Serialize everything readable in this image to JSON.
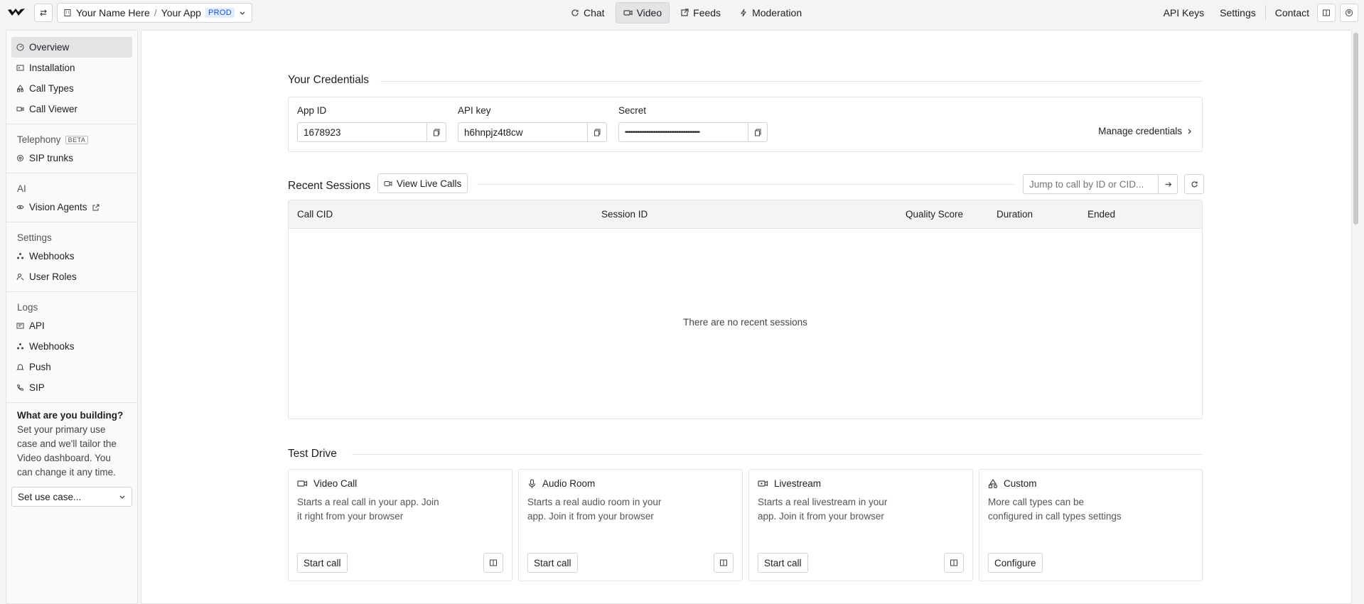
{
  "topbar": {
    "org": "Your Name Here",
    "separator": "/",
    "app": "Your App",
    "env": "PROD",
    "tabs": [
      {
        "label": "Chat",
        "icon": "chat-icon"
      },
      {
        "label": "Video",
        "icon": "video-icon"
      },
      {
        "label": "Feeds",
        "icon": "feeds-icon"
      },
      {
        "label": "Moderation",
        "icon": "moderation-icon"
      }
    ],
    "right_links": [
      "API Keys",
      "Settings",
      "Contact"
    ]
  },
  "sidebar": {
    "items_top": [
      "Overview",
      "Installation",
      "Call Types",
      "Call Viewer"
    ],
    "telephony_title": "Telephony",
    "beta": "BETA",
    "telephony_items": [
      "SIP trunks"
    ],
    "ai_title": "AI",
    "ai_items": [
      "Vision Agents"
    ],
    "settings_title": "Settings",
    "settings_items": [
      "Webhooks",
      "User Roles"
    ],
    "logs_title": "Logs",
    "logs_items": [
      "API",
      "Webhooks",
      "Push",
      "SIP"
    ],
    "note_title": "What are you building?",
    "note_body": "Set your primary use case and we'll tailor the Video dashboard. You can change it any time.",
    "select_value": "Set use case..."
  },
  "credentials": {
    "title": "Your Credentials",
    "app_id_label": "App ID",
    "app_id": "1678923",
    "api_key_label": "API key",
    "api_key": "h6hnpjz4t8cw",
    "secret_label": "Secret",
    "secret": "••••••••••••••••••••••••••••••••••••••••••",
    "manage": "Manage credentials"
  },
  "sessions": {
    "title": "Recent Sessions",
    "view_live": "View Live Calls",
    "jump_placeholder": "Jump to call by ID or CID...",
    "columns": [
      "Call CID",
      "Session ID",
      "Quality Score",
      "Duration",
      "Ended"
    ],
    "empty": "There are no recent sessions"
  },
  "test_drive": {
    "title": "Test Drive",
    "cards": [
      {
        "title": "Video Call",
        "desc": "Starts a real call in your app. Join it right from your browser",
        "button": "Start call"
      },
      {
        "title": "Audio Room",
        "desc": "Starts a real audio room in your app. Join it from your browser",
        "button": "Start call"
      },
      {
        "title": "Livestream",
        "desc": "Starts a real livestream in your app. Join it from your browser",
        "button": "Start call"
      },
      {
        "title": "Custom",
        "desc": "More call types can be configured in call types settings",
        "button": "Configure"
      }
    ]
  }
}
